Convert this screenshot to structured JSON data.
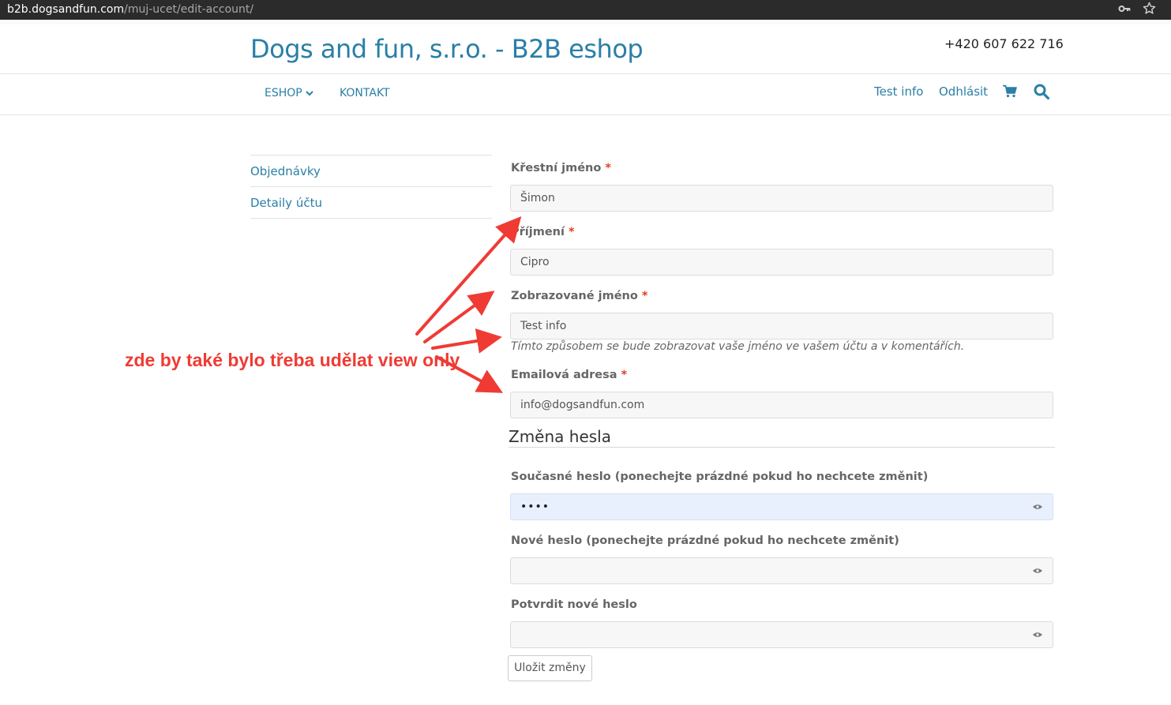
{
  "browser": {
    "url_host": "b2b.dogsandfun.com",
    "url_path": "/muj-ucet/edit-account/",
    "key_icon": "key-icon",
    "star_icon": "star-icon"
  },
  "header": {
    "site_title": "Dogs and fun, s.r.o. - B2B eshop",
    "phone": "+420 607 622 716"
  },
  "nav": {
    "eshop": "ESHOP",
    "kontakt": "KONTAKT",
    "account_name": "Test info",
    "logout": "Odhlásit",
    "cart_icon": "cart-icon",
    "search_icon": "search-icon"
  },
  "sidebar": {
    "items": [
      {
        "label": "Objednávky"
      },
      {
        "label": "Detaily účtu"
      }
    ]
  },
  "form": {
    "required_mark": "*",
    "first_name": {
      "label": "Křestní jméno",
      "value": "Šimon"
    },
    "last_name": {
      "label": "Příjmení",
      "value": "Cipro"
    },
    "display_name": {
      "label": "Zobrazované jméno",
      "value": "Test info",
      "hint": "Tímto způsobem se bude zobrazovat vaše jméno ve vašem účtu a v komentářích."
    },
    "email": {
      "label": "Emailová adresa",
      "value": "info@dogsandfun.com"
    },
    "password_section_title": "Změna hesla",
    "current_password": {
      "label": "Současné heslo (ponechejte prázdné pokud ho nechcete změnit)",
      "value": "••••"
    },
    "new_password": {
      "label": "Nové heslo (ponechejte prázdné pokud ho nechcete změnit)",
      "value": ""
    },
    "confirm_password": {
      "label": "Potvrdit nové heslo",
      "value": ""
    },
    "save_button": "Uložit změny",
    "eye_icon": "eye-icon"
  },
  "annotation": {
    "text": "zde by také bylo třeba udělat view only",
    "color": "#ef3b34"
  }
}
